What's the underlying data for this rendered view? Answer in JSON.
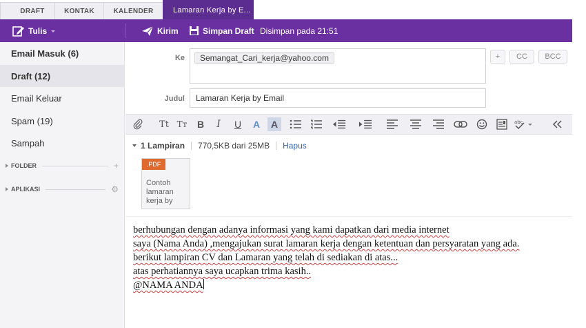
{
  "tabs": [
    {
      "label": "DRAFT"
    },
    {
      "label": "KONTAK"
    },
    {
      "label": "KALENDER"
    },
    {
      "label": "Lamaran Kerja by E..."
    }
  ],
  "toolbar": {
    "compose_label": "Tulis",
    "send_label": "Kirim",
    "save_label": "Simpan Draft",
    "status": "Disimpan pada 21:51"
  },
  "sidebar": {
    "items": [
      {
        "label": "Email Masuk (6)"
      },
      {
        "label": "Draft (12)"
      },
      {
        "label": "Email Keluar"
      },
      {
        "label": "Spam (19)"
      },
      {
        "label": "Sampah"
      }
    ],
    "sections": [
      {
        "label": "FOLDER"
      },
      {
        "label": "APLIKASI"
      }
    ]
  },
  "compose": {
    "to_label": "Ke",
    "recipient": "Semangat_Cari_kerja@yahoo.com",
    "add_label": "+",
    "cc_label": "CC",
    "bcc_label": "BCC",
    "subject_label": "Judul",
    "subject": "Lamaran Kerja by Email"
  },
  "attachments": {
    "count_label": "1 Lampiran",
    "size": "770,5KB dari 25MB",
    "delete_label": "Hapus",
    "file_type": ".PDF",
    "file_name": "Contoh lamaran kerja by"
  },
  "body": {
    "lines": [
      "berhubungan dengan adanya informasi yang kami dapatkan dari media internet",
      "saya (Nama Anda) ,mengajukan surat lamaran kerja dengan ketentuan dan persyaratan yang ada.",
      "berikut lampiran CV dan Lamaran yang telah di sediakan di atas...",
      "atas perhatiannya saya ucapkan trima kasih..",
      "@NAMA ANDA"
    ]
  },
  "colors": {
    "accent": "#6a2fa0",
    "tab_active": "#5c2d91",
    "pdf_badge": "#e06a2d",
    "link": "#2d63b0"
  }
}
